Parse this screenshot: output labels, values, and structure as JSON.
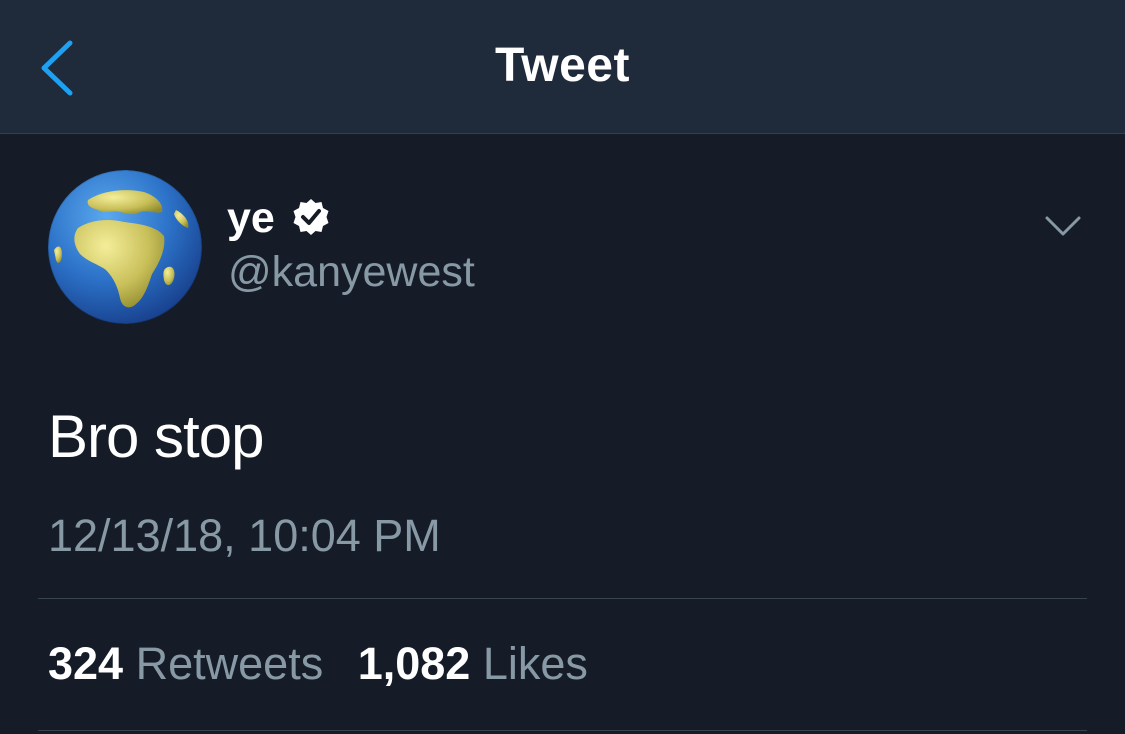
{
  "header": {
    "title": "Tweet",
    "back_icon": "chevron-left-icon"
  },
  "colors": {
    "accent": "#1da1f2",
    "background": "#151c27",
    "navbar": "#1f2a3a",
    "secondary_text": "#8899a6",
    "primary_text": "#ffffff"
  },
  "tweet": {
    "author": {
      "display_name": "ye",
      "handle": "@kanyewest",
      "verified": true,
      "avatar": "earth-globe-africa-icon"
    },
    "text": "Bro stop",
    "timestamp": "12/13/18, 10:04 PM",
    "stats": {
      "retweets_count": "324",
      "retweets_label": "Retweets",
      "likes_count": "1,082",
      "likes_label": "Likes"
    },
    "menu_icon": "chevron-down-icon"
  }
}
